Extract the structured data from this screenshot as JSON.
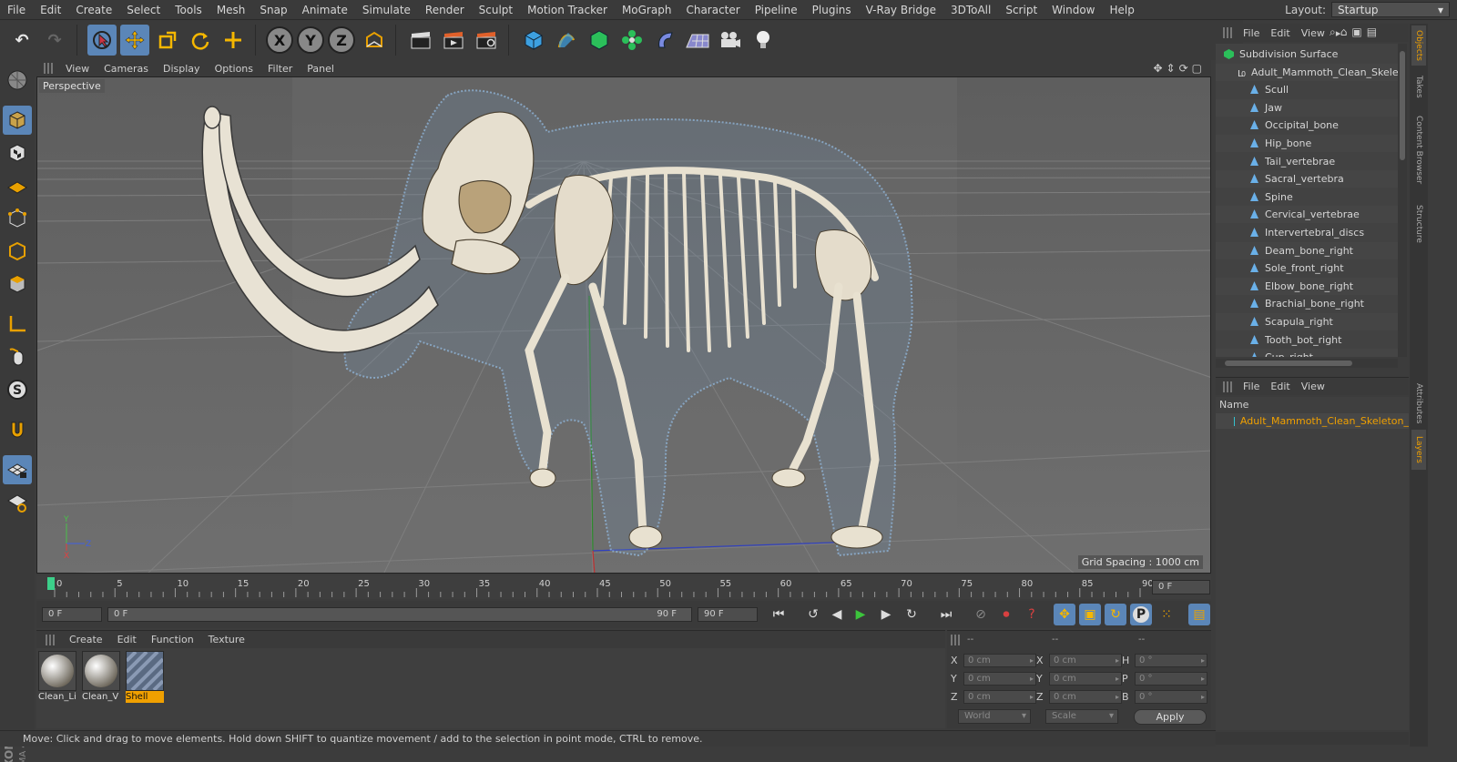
{
  "menubar": {
    "items": [
      "File",
      "Edit",
      "Create",
      "Select",
      "Tools",
      "Mesh",
      "Snap",
      "Animate",
      "Simulate",
      "Render",
      "Sculpt",
      "Motion Tracker",
      "MoGraph",
      "Character",
      "Pipeline",
      "Plugins",
      "V-Ray Bridge",
      "3DToAll",
      "Script",
      "Window",
      "Help"
    ],
    "layout_label": "Layout:",
    "layout_value": "Startup"
  },
  "viewport": {
    "menu": [
      "View",
      "Cameras",
      "Display",
      "Options",
      "Filter",
      "Panel"
    ],
    "camera_label": "Perspective",
    "grid_spacing": "Grid Spacing : 1000 cm",
    "axis": {
      "y": "Y",
      "z": "Z",
      "x": "X"
    }
  },
  "timeline": {
    "ticks": [
      "0",
      "5",
      "10",
      "15",
      "20",
      "25",
      "30",
      "35",
      "40",
      "45",
      "50",
      "55",
      "60",
      "65",
      "70",
      "75",
      "80",
      "85",
      "90"
    ],
    "current_frame": "0 F",
    "start_field": "0 F",
    "range_start": "0 F",
    "range_end": "90 F",
    "end_field": "90 F"
  },
  "materials": {
    "menu": [
      "Create",
      "Edit",
      "Function",
      "Texture"
    ],
    "items": [
      {
        "name": "Clean_Li",
        "selected": false
      },
      {
        "name": "Clean_V",
        "selected": false
      },
      {
        "name": "Shell",
        "selected": true
      }
    ]
  },
  "coordinates": {
    "headers": [
      "--",
      "--",
      "--"
    ],
    "rows": [
      {
        "a": "X",
        "a_val": "0 cm",
        "b": "X",
        "b_val": "0 cm",
        "c": "H",
        "c_val": "0 °"
      },
      {
        "a": "Y",
        "a_val": "0 cm",
        "b": "Y",
        "b_val": "0 cm",
        "c": "P",
        "c_val": "0 °"
      },
      {
        "a": "Z",
        "a_val": "0 cm",
        "b": "Z",
        "b_val": "0 cm",
        "c": "B",
        "c_val": "0 °"
      }
    ],
    "space": "World",
    "mode": "Scale",
    "apply": "Apply"
  },
  "status": "Move: Click and drag to move elements. Hold down SHIFT to quantize movement / add to the selection in point mode, CTRL to remove.",
  "objects": {
    "menu": [
      "File",
      "Edit",
      "View"
    ],
    "items": [
      {
        "name": "Subdivision Surface",
        "indent": 0,
        "type": "subdiv"
      },
      {
        "name": "Adult_Mammoth_Clean_Skeleton",
        "indent": 1,
        "type": "null"
      },
      {
        "name": "Scull",
        "indent": 2,
        "type": "bone"
      },
      {
        "name": "Jaw",
        "indent": 2,
        "type": "bone"
      },
      {
        "name": "Occipital_bone",
        "indent": 2,
        "type": "bone"
      },
      {
        "name": "Hip_bone",
        "indent": 2,
        "type": "bone"
      },
      {
        "name": "Tail_vertebrae",
        "indent": 2,
        "type": "bone"
      },
      {
        "name": "Sacral_vertebra",
        "indent": 2,
        "type": "bone"
      },
      {
        "name": "Spine",
        "indent": 2,
        "type": "bone"
      },
      {
        "name": "Cervical_vertebrae",
        "indent": 2,
        "type": "bone"
      },
      {
        "name": "Intervertebral_discs",
        "indent": 2,
        "type": "bone"
      },
      {
        "name": "Deam_bone_right",
        "indent": 2,
        "type": "bone"
      },
      {
        "name": "Sole_front_right",
        "indent": 2,
        "type": "bone"
      },
      {
        "name": "Elbow_bone_right",
        "indent": 2,
        "type": "bone"
      },
      {
        "name": "Brachial_bone_right",
        "indent": 2,
        "type": "bone"
      },
      {
        "name": "Scapula_right",
        "indent": 2,
        "type": "bone"
      },
      {
        "name": "Tooth_bot_right",
        "indent": 2,
        "type": "bone"
      },
      {
        "name": "Cup_right",
        "indent": 2,
        "type": "bone"
      }
    ]
  },
  "layers": {
    "menu": [
      "File",
      "Edit",
      "View"
    ],
    "name_header": "Name",
    "item": "Adult_Mammoth_Clean_Skeleton_"
  },
  "side_tabs": [
    "Objects",
    "Takes",
    "Content Browser",
    "Structure",
    "Attributes",
    "Layers"
  ],
  "colors": {
    "accent": "#5b86b8",
    "highlight": "#f0a000",
    "layer_swatch": "#34c2d0"
  }
}
